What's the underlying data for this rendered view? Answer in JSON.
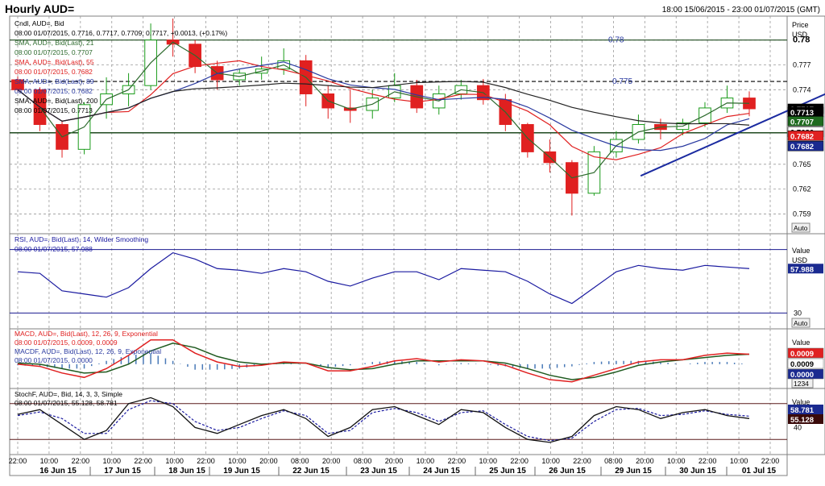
{
  "header": {
    "title": "Hourly AUD=",
    "date_range": "18:00 15/06/2015 - 23:00 01/07/2015 (GMT)"
  },
  "colors": {
    "candle_up": "#1a9b1a",
    "candle_down": "#e02020",
    "sma21": "#2e6b2e",
    "sma55": "#e02020",
    "sma89": "#2a3aa0",
    "sma200": "#222222",
    "rsi": "#1a1aa0",
    "macd": "#e02020",
    "macd_signal": "#1f5a1f",
    "stoch_k": "#111111",
    "stoch_d": "#1a1aa0",
    "hist": "#4a7ab8",
    "hline": "#1f4a1f"
  },
  "price_panel": {
    "legend": [
      {
        "text": "Cndl, AUD=, Bid",
        "color": "#000000"
      },
      {
        "text": "08:00 01/07/2015, 0.7716, 0.7717, 0.7709, 0.7717, +0.0013, (+0.17%)",
        "color": "#000000"
      },
      {
        "text": "SMA, AUD=, Bid(Last), 21",
        "color": "#2e6b2e"
      },
      {
        "text": "08:00 01/07/2015, 0.7707",
        "color": "#2e6b2e"
      },
      {
        "text": "SMA, AUD=, Bid(Last), 55",
        "color": "#e02020"
      },
      {
        "text": "08:00 01/07/2015, 0.7682",
        "color": "#e02020"
      },
      {
        "text": "SMA, AUD=, Bid(Last), 89",
        "color": "#2a3aa0"
      },
      {
        "text": "08:00 01/07/2015, 0.7682",
        "color": "#2a3aa0"
      },
      {
        "text": "SMA, AUD=, Bid(Last), 200",
        "color": "#000000"
      },
      {
        "text": "08:00 01/07/2015, 0.7713",
        "color": "#000000"
      }
    ],
    "axis_header": [
      "Price",
      "USD"
    ],
    "auto_label": "Auto",
    "ylim": [
      0.757,
      0.7825
    ],
    "ticks": [
      {
        "v": 0.78,
        "label": "0.78",
        "bold": true
      },
      {
        "v": 0.777,
        "label": "0.777"
      },
      {
        "v": 0.774,
        "label": "0.774"
      },
      {
        "v": 0.765,
        "label": "0.765"
      },
      {
        "v": 0.762,
        "label": "0.762"
      },
      {
        "v": 0.759,
        "label": "0.759"
      }
    ],
    "annotations": [
      {
        "label": "0.78",
        "v": 0.78,
        "style": "solid"
      },
      {
        "label": "0.775",
        "v": 0.775,
        "style": "dashed"
      }
    ],
    "support_level": 0.7688,
    "trendline": {
      "x1": 29.1,
      "y1": 0.7636,
      "x2": 36.4,
      "y2": 0.7734
    },
    "value_boxes": [
      {
        "text": "0.7717",
        "v": 0.7717,
        "bg": "#000000",
        "fg": "#ffffff"
      },
      {
        "text": "0.7713",
        "v": 0.7713,
        "bg": "#000000",
        "fg": "#ffffff"
      },
      {
        "text": "0.7707",
        "v": 0.7702,
        "bg": "#1f6b1f",
        "fg": "#ffffff"
      },
      {
        "text": "0.7686",
        "v": 0.7689,
        "bg": "#ffffff",
        "fg": "#000000"
      },
      {
        "text": "0.7682",
        "v": 0.76845,
        "bg": "#e02020",
        "fg": "#ffffff"
      },
      {
        "text": "0.7682",
        "v": 0.7672,
        "bg": "#1a2a90",
        "fg": "#ffffff"
      }
    ]
  },
  "rsi_panel": {
    "legend": [
      {
        "text": "RSI, AUD=, Bid(Last), 14, Wilder Smoothing",
        "color": "#1a1aa0"
      },
      {
        "text": "08:00 01/07/2015, 57.988",
        "color": "#1a1aa0"
      }
    ],
    "axis_header": [
      "Value",
      "USD"
    ],
    "auto_label": "Auto",
    "ylim": [
      20,
      80
    ],
    "hlines": [
      70,
      30
    ],
    "ticks": [
      {
        "v": 30,
        "label": "30"
      }
    ],
    "value_boxes": [
      {
        "text": "57.988",
        "v": 58,
        "bg": "#1a2a90",
        "fg": "#ffffff"
      }
    ]
  },
  "macd_panel": {
    "legend": [
      {
        "text": "MACD, AUD=, Bid(Last), 12, 26, 9, Exponential",
        "color": "#e02020"
      },
      {
        "text": "08:00 01/07/2015, 0.0009, 0.0009",
        "color": "#e02020"
      },
      {
        "text": "MACDF, AUD=, Bid(Last), 12, 26, 9, Exponential",
        "color": "#2a3aa0"
      },
      {
        "text": "08:00 01/07/2015, 0.0000",
        "color": "#2a3aa0"
      }
    ],
    "axis_header": [
      "Value"
    ],
    "scale_label": "1234",
    "ylim": [
      -0.0022,
      0.0032
    ],
    "value_boxes": [
      {
        "text": "0.0009",
        "v": 0.0009,
        "bg": "#e02020",
        "fg": "#ffffff"
      },
      {
        "text": "0.0009",
        "v": 0.0,
        "bg": "#ffffff",
        "fg": "#000000"
      },
      {
        "text": "0.0000",
        "v": -0.0009,
        "bg": "#1a2a90",
        "fg": "#ffffff"
      }
    ]
  },
  "stoch_panel": {
    "legend": [
      {
        "text": "StochF, AUD=, Bid, 14, 3, 3, Simple",
        "color": "#000000"
      },
      {
        "text": "08:00 01/07/2015, 55.128, 58.781",
        "color": "#000000"
      }
    ],
    "axis_header": [
      "Value"
    ],
    "ylim": [
      0,
      100
    ],
    "hlines": [
      80,
      20
    ],
    "ticks": [
      {
        "v": 40,
        "label": "40"
      }
    ],
    "value_boxes": [
      {
        "text": "58.781",
        "v": 63,
        "bg": "#1a2a90",
        "fg": "#ffffff"
      },
      {
        "text": "55.128",
        "v": 50,
        "bg": "#3a0a0a",
        "fg": "#ffffff"
      }
    ]
  },
  "x_axis": {
    "time_labels": [
      "22:00",
      "10:00",
      "22:00",
      "10:00",
      "22:00",
      "10:00",
      "22:00",
      "10:00",
      "20:00",
      "08:00",
      "20:00",
      "08:00",
      "20:00",
      "10:00",
      "22:00",
      "10:00",
      "22:00",
      "10:00",
      "22:00",
      "08:00",
      "20:00",
      "10:00",
      "22:00",
      "10:00",
      "22:00"
    ],
    "date_labels": [
      "16 Jun 15",
      "17 Jun 15",
      "18 Jun 15",
      "19 Jun 15",
      "22 Jun 15",
      "23 Jun 15",
      "24 Jun 15",
      "25 Jun 15",
      "26 Jun 15",
      "29 Jun 15",
      "30 Jun 15",
      "01 Jul 15"
    ]
  },
  "chart_data": {
    "type": "candlestick",
    "title": "Hourly AUD=",
    "x_unit": "half-day periods (12 hourly bars each), 16 Jun 15 to 01 Jul 15",
    "price_ohlc_approx": [
      [
        0.7752,
        0.7756,
        0.7737,
        0.774
      ],
      [
        0.774,
        0.7743,
        0.769,
        0.7698
      ],
      [
        0.7698,
        0.7703,
        0.7658,
        0.7668
      ],
      [
        0.7668,
        0.7725,
        0.7662,
        0.7722
      ],
      [
        0.7722,
        0.7755,
        0.7705,
        0.7735
      ],
      [
        0.7735,
        0.776,
        0.772,
        0.7745
      ],
      [
        0.7745,
        0.782,
        0.774,
        0.78
      ],
      [
        0.78,
        0.7826,
        0.778,
        0.7795
      ],
      [
        0.7795,
        0.78,
        0.776,
        0.7768
      ],
      [
        0.7768,
        0.7775,
        0.774,
        0.7752
      ],
      [
        0.7752,
        0.7765,
        0.7745,
        0.776
      ],
      [
        0.776,
        0.778,
        0.7752,
        0.7765
      ],
      [
        0.7765,
        0.779,
        0.7758,
        0.7775
      ],
      [
        0.7775,
        0.7782,
        0.772,
        0.7735
      ],
      [
        0.7735,
        0.7745,
        0.7705,
        0.7718
      ],
      [
        0.7718,
        0.774,
        0.77,
        0.7715
      ],
      [
        0.7715,
        0.774,
        0.7705,
        0.773
      ],
      [
        0.773,
        0.776,
        0.7725,
        0.7745
      ],
      [
        0.7745,
        0.7752,
        0.7712,
        0.7718
      ],
      [
        0.7718,
        0.7745,
        0.771,
        0.7735
      ],
      [
        0.7735,
        0.7752,
        0.7728,
        0.7745
      ],
      [
        0.7745,
        0.7753,
        0.7722,
        0.7728
      ],
      [
        0.7728,
        0.7735,
        0.769,
        0.7698
      ],
      [
        0.7698,
        0.77,
        0.7658,
        0.7665
      ],
      [
        0.7665,
        0.768,
        0.764,
        0.7652
      ],
      [
        0.7652,
        0.7655,
        0.7588,
        0.7615
      ],
      [
        0.7615,
        0.7672,
        0.7612,
        0.7665
      ],
      [
        0.7665,
        0.769,
        0.7658,
        0.768
      ],
      [
        0.768,
        0.771,
        0.7675,
        0.7698
      ],
      [
        0.7698,
        0.7705,
        0.768,
        0.7692
      ],
      [
        0.7692,
        0.7705,
        0.7685,
        0.77
      ],
      [
        0.77,
        0.7725,
        0.7695,
        0.7718
      ],
      [
        0.7718,
        0.7745,
        0.7712,
        0.773
      ],
      [
        0.773,
        0.7738,
        0.7708,
        0.7717
      ]
    ],
    "series_end_values": {
      "SMA 21": 0.7707,
      "SMA 55": 0.7682,
      "SMA 89": 0.7682,
      "SMA 200": 0.7713
    },
    "rsi": [
      56,
      55,
      44,
      42,
      40,
      46,
      58,
      68,
      64,
      58,
      57,
      55,
      58,
      56,
      50,
      47,
      52,
      56,
      56,
      51,
      58,
      57,
      56,
      50,
      42,
      36,
      46,
      56,
      60,
      58,
      57,
      60,
      59,
      58
    ],
    "macd": [
      0.0,
      -0.0002,
      -0.0008,
      -0.0012,
      -0.0004,
      0.0008,
      0.0022,
      0.0022,
      0.001,
      0.0002,
      -0.0002,
      -0.0001,
      0.0002,
      0.0001,
      -0.0006,
      -0.0006,
      -0.0002,
      0.0003,
      0.0005,
      0.0002,
      0.0004,
      0.0003,
      -0.0001,
      -0.0008,
      -0.0014,
      -0.0016,
      -0.001,
      -0.0004,
      0.0002,
      0.0004,
      0.0004,
      0.0008,
      0.001,
      0.0009
    ],
    "macd_signal": [
      0.0001,
      0.0,
      -0.0004,
      -0.0008,
      -0.0007,
      0.0,
      0.0012,
      0.0019,
      0.0015,
      0.0007,
      0.0002,
      0.0,
      0.0001,
      0.0001,
      -0.0003,
      -0.0005,
      -0.0004,
      0.0,
      0.0003,
      0.0003,
      0.0003,
      0.0003,
      0.0001,
      -0.0004,
      -0.001,
      -0.0014,
      -0.0012,
      -0.0007,
      -0.0001,
      0.0002,
      0.0004,
      0.0006,
      0.0008,
      0.0009
    ],
    "stoch_k": [
      62,
      70,
      45,
      20,
      35,
      80,
      90,
      75,
      40,
      30,
      45,
      60,
      70,
      55,
      25,
      40,
      70,
      75,
      60,
      45,
      70,
      65,
      40,
      20,
      15,
      25,
      60,
      75,
      70,
      55,
      65,
      70,
      60,
      55
    ],
    "stoch_d": [
      60,
      66,
      55,
      30,
      30,
      70,
      85,
      80,
      50,
      35,
      40,
      55,
      68,
      60,
      30,
      35,
      65,
      72,
      65,
      50,
      65,
      68,
      45,
      25,
      18,
      22,
      50,
      70,
      72,
      60,
      62,
      68,
      62,
      59
    ],
    "hlines": {
      "price": [
        0.78,
        0.775
      ],
      "support": 0.7688
    }
  }
}
